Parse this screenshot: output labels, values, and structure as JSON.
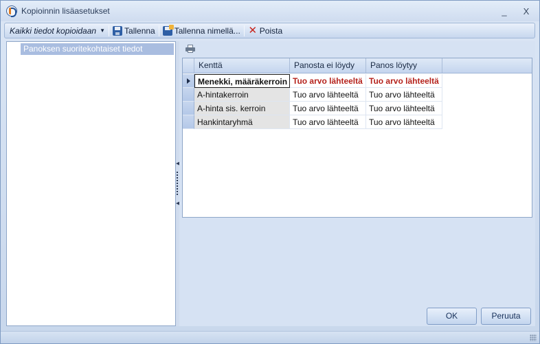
{
  "window": {
    "title": "Kopioinnin lisäasetukset",
    "minimize_glyph": "_",
    "close_glyph": "X"
  },
  "toolbar": {
    "copy_mode": "Kaikki tiedot kopioidaan",
    "save_label": "Tallenna",
    "save_as_label": "Tallenna nimellä...",
    "delete_label": "Poista"
  },
  "tree": {
    "items": [
      "Panoksen suoritekohtaiset tiedot"
    ]
  },
  "grid": {
    "columns": [
      "Kenttä",
      "Panosta ei löydy",
      "Panos löytyy"
    ],
    "rows": [
      {
        "field": "Menekki, määräkerroin",
        "not_found": "Tuo arvo lähteeltä",
        "found": "Tuo arvo lähteeltä",
        "current": true
      },
      {
        "field": "A-hintakerroin",
        "not_found": "Tuo arvo lähteeltä",
        "found": "Tuo arvo lähteeltä",
        "current": false
      },
      {
        "field": "A-hinta sis. kerroin",
        "not_found": "Tuo arvo lähteeltä",
        "found": "Tuo arvo lähteeltä",
        "current": false
      },
      {
        "field": "Hankintaryhmä",
        "not_found": "Tuo arvo lähteeltä",
        "found": "Tuo arvo lähteeltä",
        "current": false
      }
    ]
  },
  "buttons": {
    "ok": "OK",
    "cancel": "Peruuta"
  },
  "colors": {
    "accent_red": "#b5231d",
    "selection": "#a9bde0",
    "chrome": "#cfdcee"
  },
  "icons": {
    "print": "printer-icon",
    "save": "floppy-disk-icon",
    "save_as": "floppy-disk-star-icon",
    "delete": "red-x-icon"
  }
}
